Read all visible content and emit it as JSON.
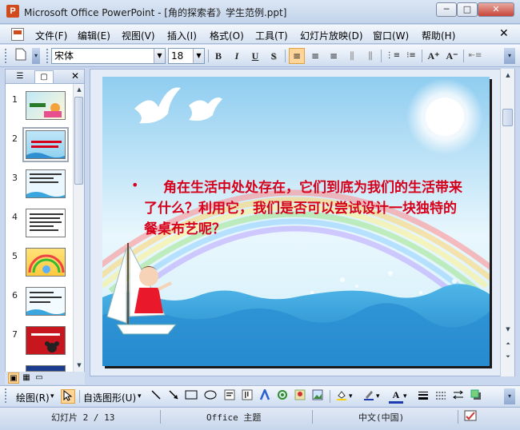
{
  "window": {
    "app_icon_letter": "P",
    "title": "Microsoft Office PowerPoint - [角的探索者》学生范例.ppt]",
    "minimize": "─",
    "maximize": "□",
    "close": "✕"
  },
  "menu": {
    "items": [
      "文件(F)",
      "编辑(E)",
      "视图(V)",
      "插入(I)",
      "格式(O)",
      "工具(T)",
      "幻灯片放映(D)",
      "窗口(W)",
      "帮助(H)"
    ],
    "close_glyph": "✕"
  },
  "format_toolbar": {
    "font_name": "宋体",
    "font_size": "18",
    "bold": "B",
    "italic": "I",
    "underline": "U",
    "shadow": "S",
    "align_left": "≡",
    "align_center": "≡",
    "align_right": "≡",
    "distribute": "⫼",
    "numbering": "⋮≡",
    "bullets": "⁝≡",
    "increase_font": "A⁺",
    "decrease_font": "A⁻",
    "indent": "⇤≡",
    "more": "▾"
  },
  "slides_pane": {
    "tab_outline": "☰",
    "tab_slides": "▢",
    "close": "✕",
    "numbers": [
      "1",
      "2",
      "3",
      "4",
      "5",
      "6",
      "7"
    ],
    "selected_index": 2
  },
  "slide": {
    "bullet": "•",
    "text": "角在生活中处处存在，它们到底为我们的生活带来了什么？利用它，我们是否可以尝试设计一块独特的餐桌布艺呢？"
  },
  "drawing_toolbar": {
    "draw_label": "绘图(R)",
    "autoshapes_label": "自选图形(U)",
    "dropdown": "▾"
  },
  "status_bar": {
    "slide_info": "幻灯片 2 / 13",
    "theme": "Office 主题",
    "language": "中文(中国)"
  },
  "colors": {
    "slide_text": "#d6001b",
    "accent_selected": "#ffd59a"
  }
}
